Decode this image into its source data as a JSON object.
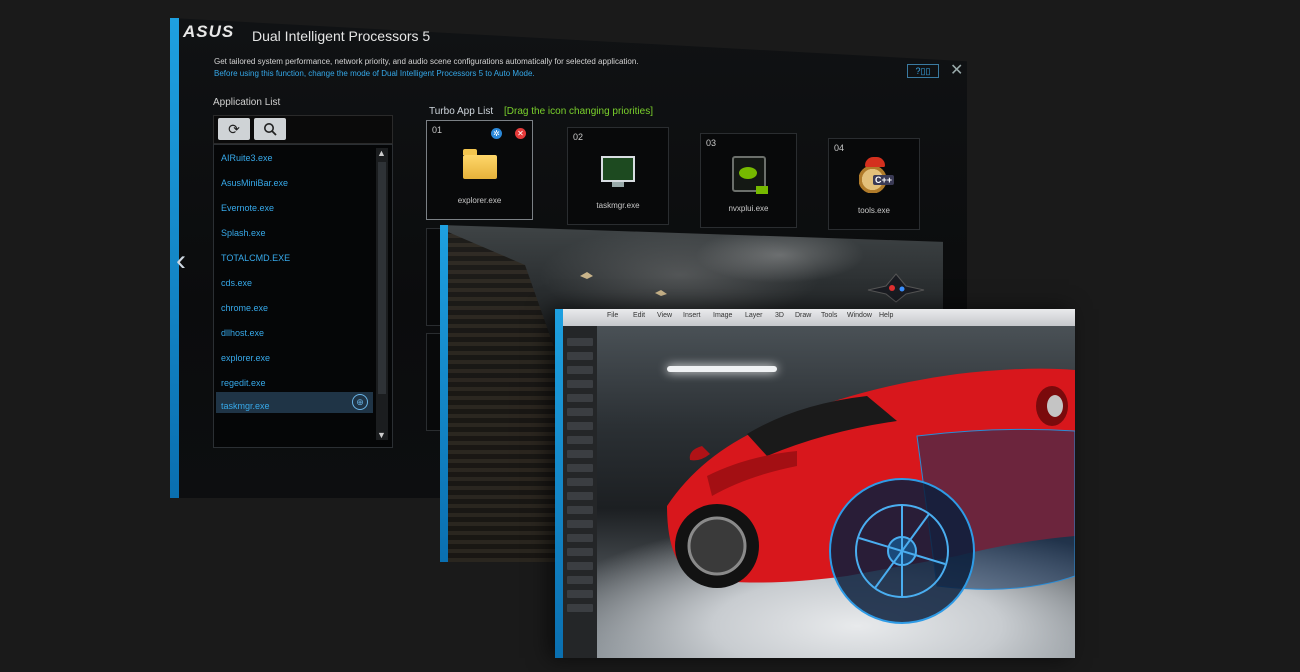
{
  "window": {
    "brand": "ASUS",
    "title": "Dual Intelligent Processors 5",
    "description_line1": "Get tailored system performance, network priority, and audio scene configurations automatically for selected application.",
    "description_line2": "Before using this function, change the mode of Dual Intelligent Processors 5 to Auto Mode."
  },
  "application_list": {
    "label": "Application List",
    "items": [
      "AIRuite3.exe",
      "AsusMiniBar.exe",
      "Evernote.exe",
      "Splash.exe",
      "TOTALCMD.EXE",
      "cds.exe",
      "chrome.exe",
      "dllhost.exe",
      "explorer.exe",
      "regedit.exe",
      "taskmgr.exe"
    ],
    "selected": "taskmgr.exe"
  },
  "turbo": {
    "label": "Turbo App List",
    "hint": "[Drag the icon changing priorities]",
    "tiles": [
      {
        "num": "01",
        "name": "explorer.exe",
        "icon": "folder-icon"
      },
      {
        "num": "02",
        "name": "taskmgr.exe",
        "icon": "monitor-icon"
      },
      {
        "num": "03",
        "name": "nvxplui.exe",
        "icon": "nvidia-icon"
      },
      {
        "num": "04",
        "name": "tools.exe",
        "icon": "helmet-icon"
      }
    ]
  },
  "front_app": {
    "menu": [
      "File",
      "Edit",
      "View",
      "Insert",
      "Image",
      "Layer",
      "3D",
      "Draw",
      "Tools",
      "Window",
      "Help"
    ]
  },
  "colors": {
    "accent": "#1ea0e0",
    "list_text": "#37a9ea",
    "hint": "#7ad12c",
    "car": "#d8171c"
  }
}
